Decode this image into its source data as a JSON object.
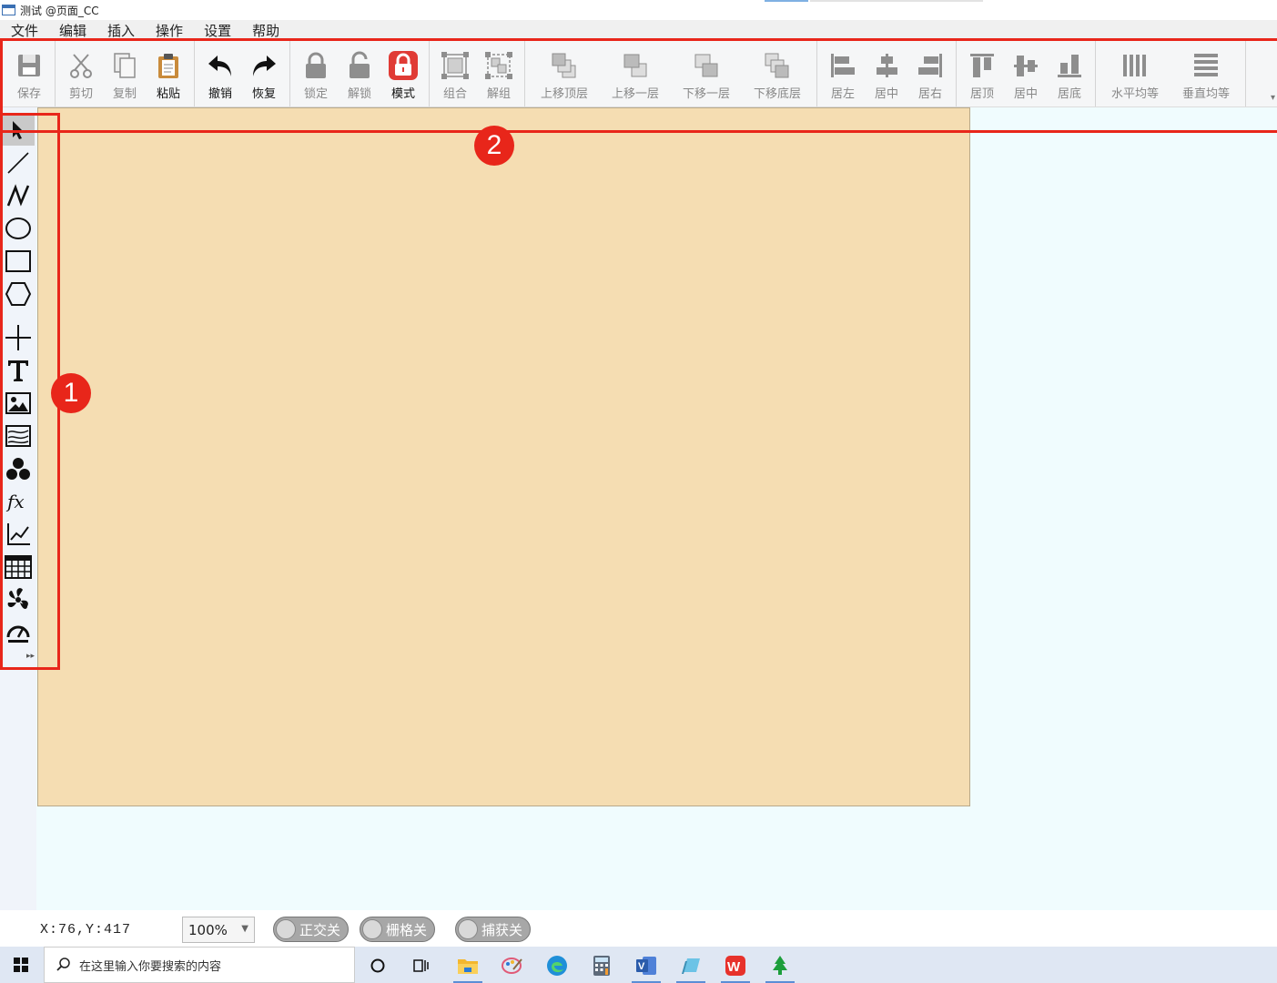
{
  "window": {
    "title": "测试 @页面_CC"
  },
  "menu": [
    "文件",
    "编辑",
    "插入",
    "操作",
    "设置",
    "帮助"
  ],
  "toolbar": {
    "groups": [
      [
        {
          "label": "保存",
          "icon": "save-icon",
          "active": false
        }
      ],
      [
        {
          "label": "剪切",
          "icon": "cut-icon",
          "active": false
        },
        {
          "label": "复制",
          "icon": "copy-icon",
          "active": false
        },
        {
          "label": "粘贴",
          "icon": "paste-icon",
          "active": true
        }
      ],
      [
        {
          "label": "撤销",
          "icon": "undo-icon",
          "active": true
        },
        {
          "label": "恢复",
          "icon": "redo-icon",
          "active": true
        }
      ],
      [
        {
          "label": "锁定",
          "icon": "lock-icon",
          "active": false
        },
        {
          "label": "解锁",
          "icon": "unlock-icon",
          "active": false
        },
        {
          "label": "模式",
          "icon": "mode-lock-icon",
          "active": true
        }
      ],
      [
        {
          "label": "组合",
          "icon": "group-icon",
          "active": false
        },
        {
          "label": "解组",
          "icon": "ungroup-icon",
          "active": false
        }
      ],
      [
        {
          "label": "上移顶层",
          "icon": "bring-to-front-icon",
          "active": false
        },
        {
          "label": "上移一层",
          "icon": "bring-forward-icon",
          "active": false
        },
        {
          "label": "下移一层",
          "icon": "send-backward-icon",
          "active": false
        },
        {
          "label": "下移底层",
          "icon": "send-to-back-icon",
          "active": false
        }
      ],
      [
        {
          "label": "居左",
          "icon": "align-left-icon",
          "active": false
        },
        {
          "label": "居中",
          "icon": "align-center-icon",
          "active": false
        },
        {
          "label": "居右",
          "icon": "align-right-icon",
          "active": false
        }
      ],
      [
        {
          "label": "居顶",
          "icon": "align-top-icon",
          "active": false
        },
        {
          "label": "居中",
          "icon": "align-middle-icon",
          "active": false
        },
        {
          "label": "居底",
          "icon": "align-bottom-icon",
          "active": false
        }
      ],
      [
        {
          "label": "水平均等",
          "icon": "distribute-horizontal-icon",
          "active": false
        },
        {
          "label": "垂直均等",
          "icon": "distribute-vertical-icon",
          "active": false
        }
      ]
    ]
  },
  "tools": [
    "pointer-icon",
    "line-icon",
    "polyline-icon",
    "ellipse-icon",
    "rectangle-icon",
    "polygon-icon",
    "cross-icon",
    "text-icon",
    "image-icon",
    "image-frame-icon",
    "shapes-icon",
    "formula-icon",
    "line-chart-icon",
    "table-icon",
    "fan-icon",
    "gauge-icon"
  ],
  "annotations": {
    "badge1": "1",
    "badge2": "2"
  },
  "status": {
    "coords": "X:76,Y:417",
    "zoom": "100%",
    "toggles": [
      "正交关",
      "栅格关",
      "捕获关"
    ]
  },
  "taskbar": {
    "search_placeholder": "在这里输入你要搜索的内容",
    "apps": [
      "cortana-icon",
      "task-view-icon",
      "file-explorer-icon",
      "paint-icon",
      "edge-icon",
      "calculator-icon",
      "visio-icon",
      "notes-icon",
      "wps-icon",
      "tree-app-icon"
    ]
  },
  "colors": {
    "accent": "#e8261a",
    "page_bg": "#f5ddb2",
    "workspace_bg": "#f0fcfe",
    "toolbar_bg": "#f5f6f7"
  }
}
